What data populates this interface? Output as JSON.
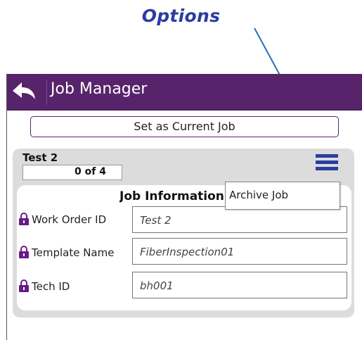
{
  "annotation": {
    "label": "Options"
  },
  "window": {
    "title": "Job Manager",
    "set_current_button": "Set as Current Job"
  },
  "job": {
    "name": "Test 2",
    "progress_text": "0 of 4",
    "progress": {
      "done": 0,
      "total": 4
    }
  },
  "menu": {
    "items": [
      "Archive Job"
    ]
  },
  "info": {
    "title": "Job Information",
    "fields": [
      {
        "label": "Work Order ID",
        "value": "Test 2"
      },
      {
        "label": "Template Name",
        "value": "FiberInspection01"
      },
      {
        "label": "Tech ID",
        "value": "bh001"
      }
    ]
  },
  "colors": {
    "titlebar": "#57246b",
    "accent": "#2a3da0",
    "panel": "#dcdcdc"
  },
  "icons": [
    "back-arrow-icon",
    "hamburger-menu-icon",
    "lock-icon"
  ]
}
